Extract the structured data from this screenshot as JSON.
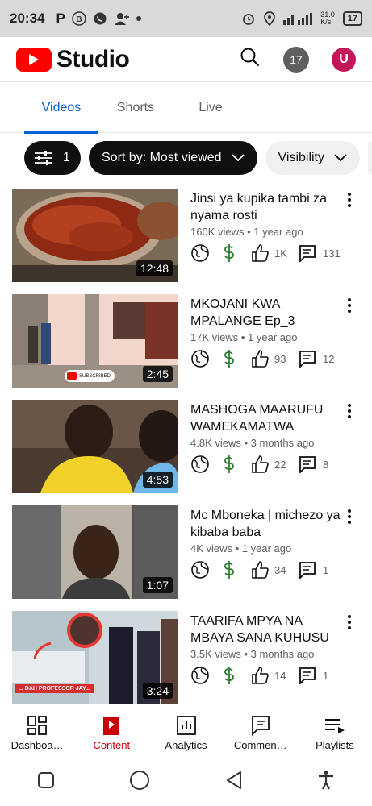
{
  "status_bar": {
    "time": "20:34",
    "left_icons": [
      "p-icon",
      "b-icon",
      "whatsapp-icon",
      "add-contact-icon",
      "dot-icon"
    ],
    "network": "31.0\nK/s",
    "battery": "17"
  },
  "app": {
    "name": "Studio",
    "notifications": "17",
    "avatar_letter": "U",
    "brand_color": "#ff0000"
  },
  "tabs": [
    {
      "label": "Videos",
      "active": true
    },
    {
      "label": "Shorts",
      "active": false
    },
    {
      "label": "Live",
      "active": false
    }
  ],
  "filters": {
    "count": "1",
    "sort_label": "Sort by: Most viewed",
    "visibility_label": "Visibility"
  },
  "videos": [
    {
      "title": "Jinsi ya kupika tambi za nyama rosti",
      "meta": "160K views • 1 year ago",
      "duration": "12:48",
      "likes": "1K",
      "comments": "131"
    },
    {
      "title": "MKOJANI KWA MPALANGE Ep_3",
      "meta": "17K views • 1 year ago",
      "duration": "2:45",
      "likes": "93",
      "comments": "12"
    },
    {
      "title": "MASHOGA MAARUFU WAMEKAMATWA WANAL…",
      "meta": "4.8K views • 3 months ago",
      "duration": "4:53",
      "likes": "22",
      "comments": "8"
    },
    {
      "title": "Mc Mboneka | michezo ya kibaba baba",
      "meta": "4K views • 1 year ago",
      "duration": "1:07",
      "likes": "34",
      "comments": "1"
    },
    {
      "title": "TAARIFA MPYA NA MBAYA SANA KUHUSU P…",
      "meta": "3.5K views • 3 months ago",
      "duration": "3:24",
      "likes": "14",
      "comments": "1"
    }
  ],
  "thumb_captions": {
    "subscribed": "SUBSCRIBED",
    "dah": "... DAH PROFESSOR JAY..."
  },
  "bottom_nav": [
    {
      "label": "Dashboa…",
      "icon": "dashboard-icon",
      "active": false
    },
    {
      "label": "Content",
      "icon": "content-icon",
      "active": true
    },
    {
      "label": "Analytics",
      "icon": "analytics-icon",
      "active": false
    },
    {
      "label": "Commen…",
      "icon": "comments-icon",
      "active": false
    },
    {
      "label": "Playlists",
      "icon": "playlists-icon",
      "active": false
    }
  ],
  "colors": {
    "active_tab": "#065fd4",
    "active_nav": "#cc0000",
    "monetization": "#2e7d32"
  }
}
